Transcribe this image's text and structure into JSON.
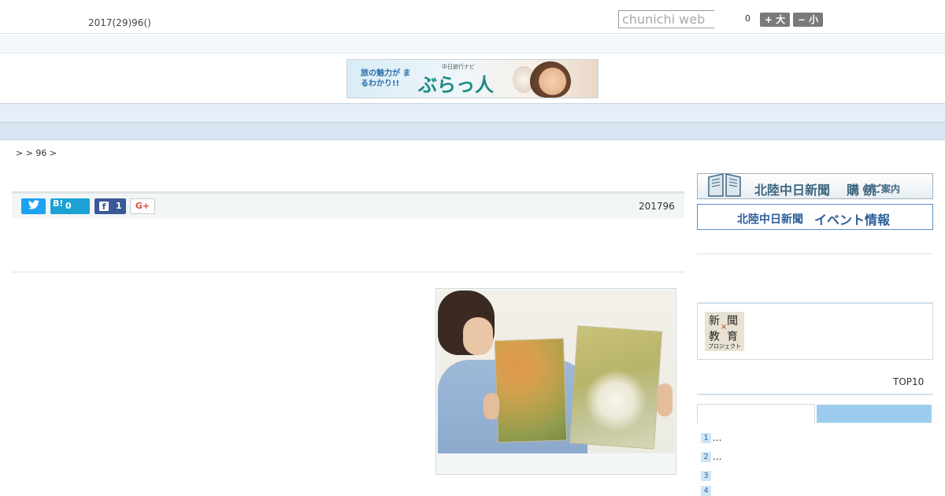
{
  "header": {
    "date": "2017(29)96()",
    "search_placeholder": "chunichi web",
    "font_count": "0",
    "font_large": "+ 大",
    "font_small": "− 小"
  },
  "banner": {
    "tagline": "旅の魅力が まるわかり!!",
    "subtitle": "中日旅行ナビ",
    "logo": "ぶらっ人"
  },
  "nav": {
    "items": [
      "",
      "",
      "",
      "",
      "",
      "",
      "",
      "",
      ""
    ]
  },
  "breadcrumb": ">  > 96 >",
  "share": {
    "twitter": "",
    "hatena_label": "B!",
    "hatena_count": "0",
    "facebook_icon": "f",
    "facebook_count": "1",
    "googleplus": "G+"
  },
  "article": {
    "date": "201796"
  },
  "sidebar": {
    "subscribe_title": "北陸中日新聞",
    "subscribe_accent": "購 読",
    "subscribe_tail": "のご案内",
    "event_title_a": "北陸中日新聞",
    "event_title_b": "イベント情報",
    "nie_logo": [
      "新",
      "聞",
      "教",
      "育"
    ],
    "nie_x": "×",
    "nie_project": "プロジェクト",
    "top10_label": "TOP10",
    "ranking": [
      {
        "num": "1",
        "text": "..."
      },
      {
        "num": "2",
        "text": "..."
      },
      {
        "num": "3",
        "text": ""
      },
      {
        "num": "4",
        "text": ""
      }
    ]
  },
  "colors": {
    "nav_bg": "#e6eef7",
    "subnav_bg": "#d8e5f3",
    "tab_active": "#9dcdee",
    "twitter": "#1da1f2",
    "hatena": "#1ba1d4",
    "facebook": "#3b5998"
  },
  "icons": {
    "twitter": "twitter-icon",
    "hatena": "hatena-bookmark-icon",
    "facebook": "facebook-icon",
    "googleplus": "googleplus-icon",
    "book": "open-book-icon"
  }
}
